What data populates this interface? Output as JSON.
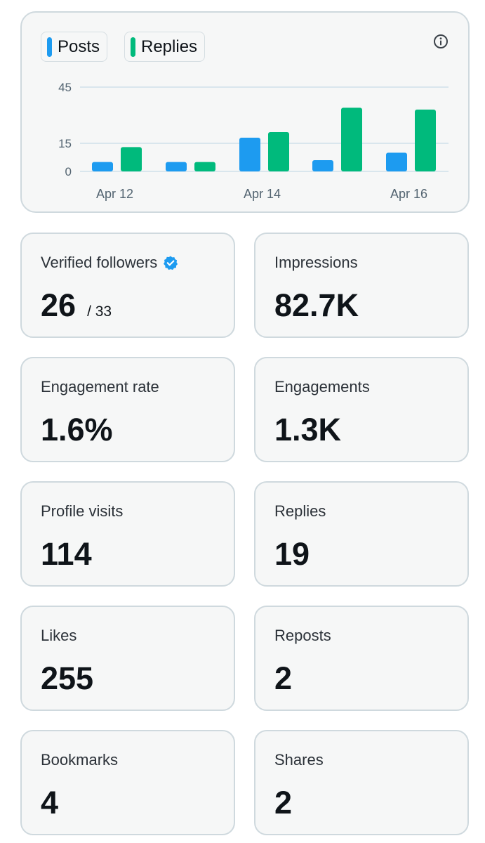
{
  "legend": {
    "posts": {
      "label": "Posts",
      "color": "#1d9bf0"
    },
    "replies": {
      "label": "Replies",
      "color": "#00ba7c"
    }
  },
  "icons": {
    "info": "info-circle-icon",
    "verified": "verified-badge-icon"
  },
  "chart_data": {
    "type": "bar",
    "x_ticks": [
      "Apr 12",
      "Apr 14",
      "Apr 16"
    ],
    "y_ticks": [
      0,
      15,
      45
    ],
    "ylim": [
      0,
      45
    ],
    "categories": [
      "Apr 12",
      "Apr 13",
      "Apr 14",
      "Apr 15",
      "Apr 16"
    ],
    "series": [
      {
        "name": "Posts",
        "color": "#1d9bf0",
        "values": [
          5,
          5,
          18,
          6,
          10
        ]
      },
      {
        "name": "Replies",
        "color": "#00ba7c",
        "values": [
          13,
          5,
          21,
          34,
          33
        ]
      }
    ],
    "grid": true
  },
  "stats": {
    "verified_followers": {
      "title": "Verified followers",
      "value": "26",
      "sub": "/ 33"
    },
    "impressions": {
      "title": "Impressions",
      "value": "82.7K"
    },
    "engagement_rate": {
      "title": "Engagement rate",
      "value": "1.6%"
    },
    "engagements": {
      "title": "Engagements",
      "value": "1.3K"
    },
    "profile_visits": {
      "title": "Profile visits",
      "value": "114"
    },
    "replies": {
      "title": "Replies",
      "value": "19"
    },
    "likes": {
      "title": "Likes",
      "value": "255"
    },
    "reposts": {
      "title": "Reposts",
      "value": "2"
    },
    "bookmarks": {
      "title": "Bookmarks",
      "value": "4"
    },
    "shares": {
      "title": "Shares",
      "value": "2"
    }
  }
}
